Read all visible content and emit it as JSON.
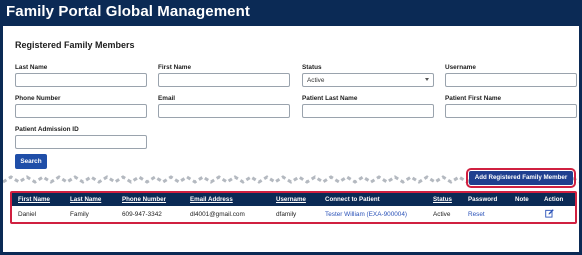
{
  "header": {
    "title": "Family Portal Global Management"
  },
  "section": {
    "title": "Registered Family Members"
  },
  "form": {
    "last_name": {
      "label": "Last Name",
      "value": ""
    },
    "first_name": {
      "label": "First Name",
      "value": ""
    },
    "status": {
      "label": "Status",
      "value": "Active"
    },
    "username": {
      "label": "Username",
      "value": ""
    },
    "phone_number": {
      "label": "Phone Number",
      "value": ""
    },
    "email": {
      "label": "Email",
      "value": ""
    },
    "patient_last_name": {
      "label": "Patient Last Name",
      "value": ""
    },
    "patient_first_name": {
      "label": "Patient First Name",
      "value": ""
    },
    "patient_admission_id": {
      "label": "Patient Admission ID",
      "value": ""
    },
    "search_label": "Search"
  },
  "actions": {
    "add_label": "Add Registered Family Member"
  },
  "colors": {
    "header": "#0b2a55",
    "button": "#1f4ea8",
    "highlight": "#d02040",
    "link": "#2a52b8"
  },
  "table": {
    "columns": [
      "First Name",
      "Last Name",
      "Phone Number",
      "Email Address",
      "Username",
      "Connect to Patient",
      "Status",
      "Password",
      "Note",
      "Action"
    ],
    "rows": [
      {
        "first_name": "Daniel",
        "last_name": "Family",
        "phone": "609-947-3342",
        "email": "dl4001@gmail.com",
        "username": "dfamily",
        "patient": "Tester William (EXA-900004)",
        "status": "Active",
        "password": "Reset",
        "note": "",
        "action_icon": "edit-icon"
      }
    ]
  }
}
